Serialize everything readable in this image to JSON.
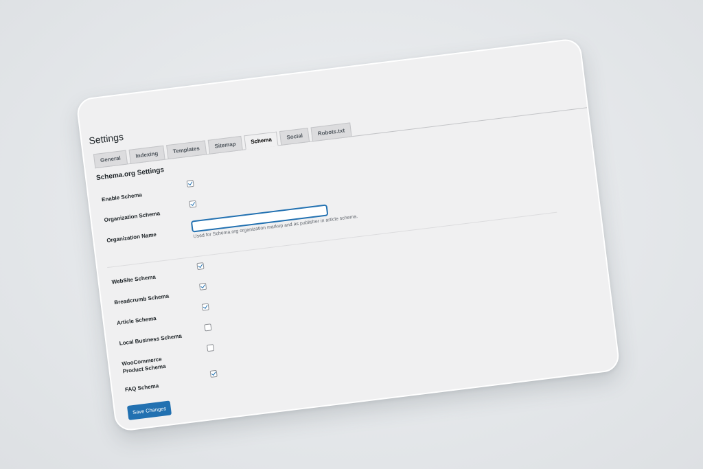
{
  "page": {
    "title": "Settings"
  },
  "tabs": [
    {
      "label": "General",
      "active": false
    },
    {
      "label": "Indexing",
      "active": false
    },
    {
      "label": "Templates",
      "active": false
    },
    {
      "label": "Sitemap",
      "active": false
    },
    {
      "label": "Schema",
      "active": true
    },
    {
      "label": "Social",
      "active": false
    },
    {
      "label": "Robots.txt",
      "active": false
    }
  ],
  "section": {
    "title": "Schema.org Settings"
  },
  "fields": {
    "enable_schema": {
      "label": "Enable Schema",
      "checked": true
    },
    "organization_schema": {
      "label": "Organization Schema",
      "checked": true
    },
    "organization_name": {
      "label": "Organization Name",
      "value": "",
      "placeholder": "",
      "help": "Used for Schema.org organization markup and as publisher in article schema."
    },
    "website_schema": {
      "label": "WebSite Schema",
      "checked": true
    },
    "breadcrumb_schema": {
      "label": "Breadcrumb Schema",
      "checked": true
    },
    "article_schema": {
      "label": "Article Schema",
      "checked": true
    },
    "local_business_schema": {
      "label": "Local Business Schema",
      "checked": false
    },
    "woocommerce_product_schema": {
      "label": "WooCommerce Product Schema",
      "checked": false
    },
    "faq_schema": {
      "label": "FAQ Schema",
      "checked": true
    }
  },
  "actions": {
    "save_label": "Save Changes"
  },
  "colors": {
    "accent": "#2271b1",
    "background": "#f0f0f1",
    "text": "#1d2327"
  }
}
